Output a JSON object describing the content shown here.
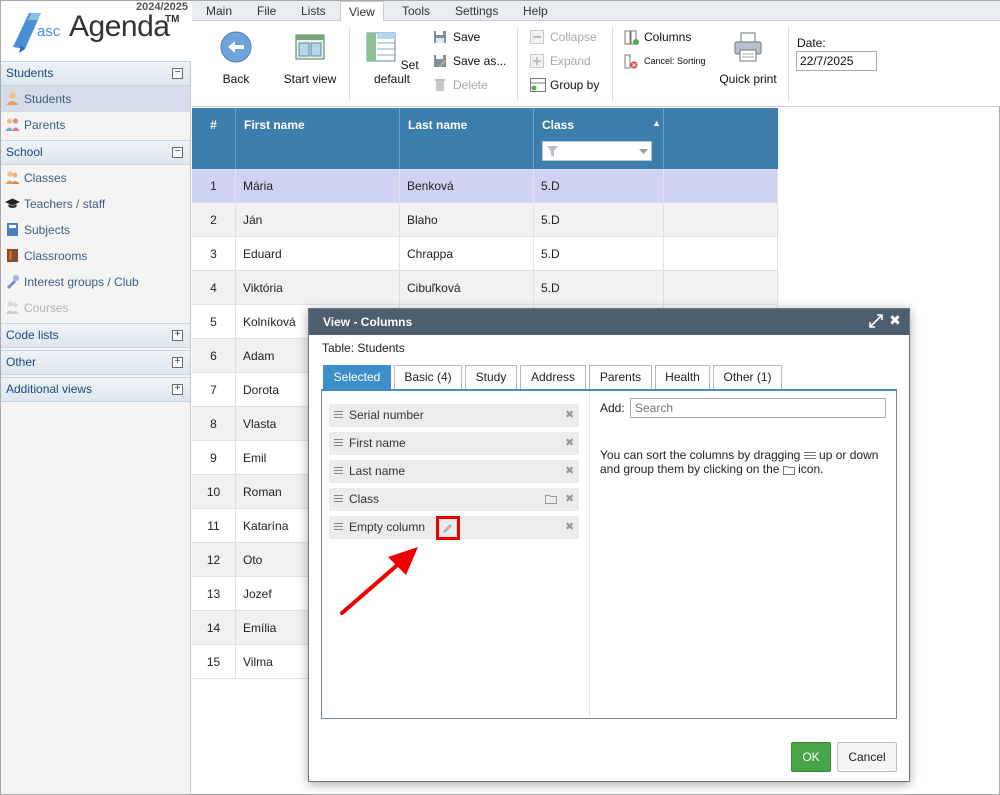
{
  "logo": {
    "year": "2024/2025",
    "asc": "asc",
    "agenda": "Agenda",
    "tm": "TM"
  },
  "sidebar": {
    "sections": [
      {
        "label": "Students",
        "toggle": "−"
      },
      {
        "label": "School",
        "toggle": "−"
      },
      {
        "label": "Code lists",
        "toggle": "+"
      },
      {
        "label": "Other",
        "toggle": "+"
      },
      {
        "label": "Additional views",
        "toggle": "+"
      }
    ],
    "items": [
      {
        "label": "Students",
        "icon": "student-icon"
      },
      {
        "label": "Parents",
        "icon": "parents-icon"
      },
      {
        "label": "Classes",
        "icon": "classes-icon"
      },
      {
        "label": "Teachers / staff",
        "icon": "graduation-cap-icon"
      },
      {
        "label": "Subjects",
        "icon": "subject-book-icon"
      },
      {
        "label": "Classrooms",
        "icon": "classroom-door-icon"
      },
      {
        "label": "Interest groups / Club",
        "icon": "interest-groups-icon"
      },
      {
        "label": "Courses",
        "icon": "courses-icon"
      }
    ]
  },
  "menu": {
    "tabs": [
      "Main",
      "File",
      "Lists",
      "View",
      "Tools",
      "Settings",
      "Help"
    ],
    "active": "View"
  },
  "ribbon": {
    "back": "Back",
    "start_view": "Start view",
    "set_default": "Set default",
    "save": "Save",
    "save_as": "Save as...",
    "delete": "Delete",
    "collapse": "Collapse",
    "expand": "Expand",
    "group_by": "Group by",
    "columns": "Columns",
    "cancel_sorting": "Cancel: Sorting",
    "quick_print": "Quick print",
    "date_label": "Date:",
    "date_value": "22/7/2025"
  },
  "grid": {
    "headers": [
      "#",
      "First name",
      "Last name",
      "Class"
    ],
    "sort_indicator": "▲",
    "rows": [
      {
        "n": "1",
        "first": "Mária",
        "last": "Benková",
        "cls": "5.D"
      },
      {
        "n": "2",
        "first": "Ján",
        "last": "Blaho",
        "cls": "5.D"
      },
      {
        "n": "3",
        "first": "Eduard",
        "last": "Chrappa",
        "cls": "5.D"
      },
      {
        "n": "4",
        "first": "Viktória",
        "last": "Cibuľková",
        "cls": "5.D"
      },
      {
        "n": "5",
        "first": "Kolníková",
        "last": "",
        "cls": ""
      },
      {
        "n": "6",
        "first": "Adam",
        "last": "",
        "cls": ""
      },
      {
        "n": "7",
        "first": "Dorota",
        "last": "",
        "cls": ""
      },
      {
        "n": "8",
        "first": "Vlasta",
        "last": "",
        "cls": ""
      },
      {
        "n": "9",
        "first": "Emil",
        "last": "",
        "cls": ""
      },
      {
        "n": "10",
        "first": "Roman",
        "last": "",
        "cls": ""
      },
      {
        "n": "11",
        "first": "Katarína",
        "last": "",
        "cls": ""
      },
      {
        "n": "12",
        "first": "Oto",
        "last": "",
        "cls": ""
      },
      {
        "n": "13",
        "first": "Jozef",
        "last": "",
        "cls": ""
      },
      {
        "n": "14",
        "first": "Emília",
        "last": "",
        "cls": ""
      },
      {
        "n": "15",
        "first": "Vilma",
        "last": "",
        "cls": ""
      }
    ]
  },
  "dialog": {
    "title": "View - Columns",
    "close": "✖",
    "table_label": "Table: Students",
    "tabs": [
      "Selected",
      "Basic (4)",
      "Study",
      "Address",
      "Parents",
      "Health",
      "Other (1)"
    ],
    "columns": [
      "Serial number",
      "First name",
      "Last name",
      "Class",
      "Empty column"
    ],
    "delete_glyph": "✖",
    "add_label": "Add:",
    "search_placeholder": "Search",
    "hint_part1": "You can sort the columns by dragging",
    "hint_part2": "up or down and group them by clicking on the",
    "hint_part3": "icon.",
    "ok": "OK",
    "cancel": "Cancel"
  },
  "colors": {
    "accent": "#3d8ec9",
    "grid_header": "#3e7eae",
    "ok_green": "#47a447",
    "highlight_red": "#e00000"
  }
}
